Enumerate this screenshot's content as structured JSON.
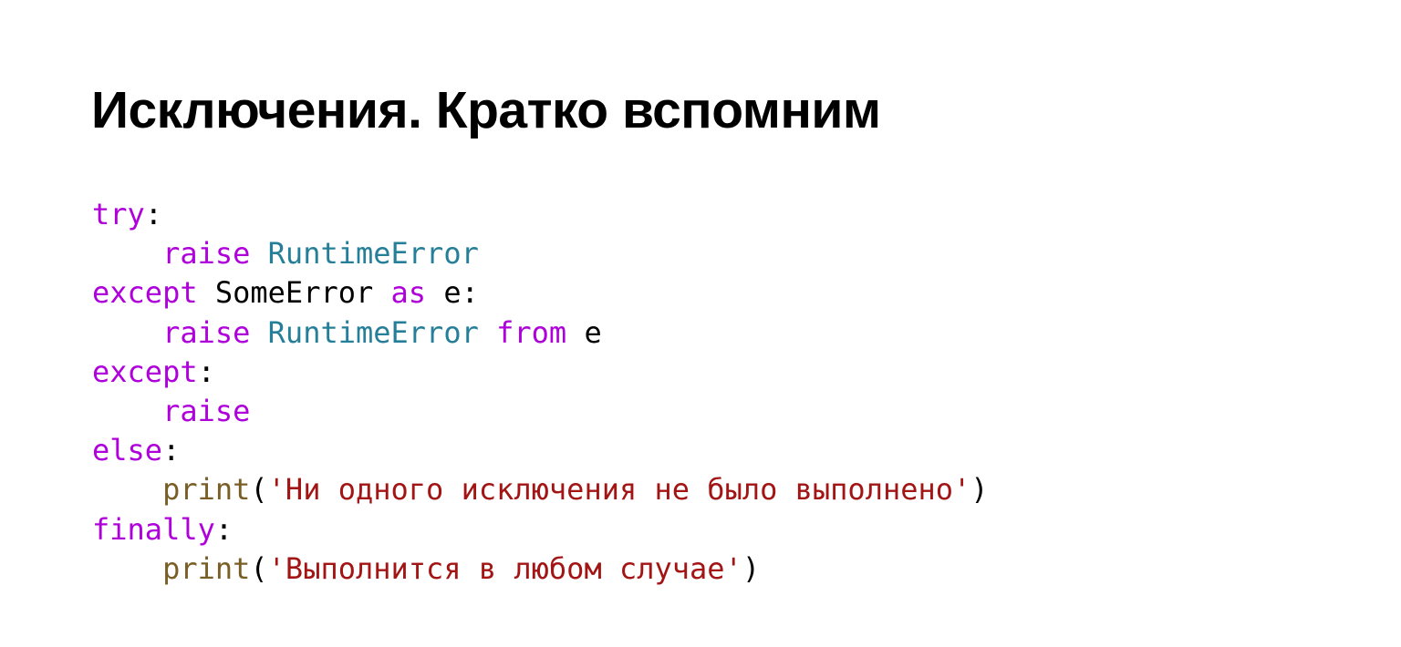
{
  "slide": {
    "title": "Исключения. Кратко вспомним"
  },
  "code": {
    "language": "python",
    "lines": [
      [
        {
          "t": "kw",
          "v": "try"
        },
        {
          "t": "pl",
          "v": ":"
        }
      ],
      [
        {
          "t": "pl",
          "v": "    "
        },
        {
          "t": "kw",
          "v": "raise"
        },
        {
          "t": "pl",
          "v": " "
        },
        {
          "t": "cls",
          "v": "RuntimeError"
        }
      ],
      [
        {
          "t": "kw",
          "v": "except"
        },
        {
          "t": "pl",
          "v": " SomeError "
        },
        {
          "t": "kw",
          "v": "as"
        },
        {
          "t": "pl",
          "v": " e:"
        }
      ],
      [
        {
          "t": "pl",
          "v": "    "
        },
        {
          "t": "kw",
          "v": "raise"
        },
        {
          "t": "pl",
          "v": " "
        },
        {
          "t": "cls",
          "v": "RuntimeError"
        },
        {
          "t": "pl",
          "v": " "
        },
        {
          "t": "kw",
          "v": "from"
        },
        {
          "t": "pl",
          "v": " e"
        }
      ],
      [
        {
          "t": "kw",
          "v": "except"
        },
        {
          "t": "pl",
          "v": ":"
        }
      ],
      [
        {
          "t": "pl",
          "v": "    "
        },
        {
          "t": "kw",
          "v": "raise"
        }
      ],
      [
        {
          "t": "kw",
          "v": "else"
        },
        {
          "t": "pl",
          "v": ":"
        }
      ],
      [
        {
          "t": "pl",
          "v": "    "
        },
        {
          "t": "fn",
          "v": "print"
        },
        {
          "t": "pl",
          "v": "("
        },
        {
          "t": "str",
          "v": "'Ни одного исключения не было выполнено'"
        },
        {
          "t": "pl",
          "v": ")"
        }
      ],
      [
        {
          "t": "kw",
          "v": "finally"
        },
        {
          "t": "pl",
          "v": ":"
        }
      ],
      [
        {
          "t": "pl",
          "v": "    "
        },
        {
          "t": "fn",
          "v": "print"
        },
        {
          "t": "pl",
          "v": "("
        },
        {
          "t": "str",
          "v": "'Выполнится в любом случае'"
        },
        {
          "t": "pl",
          "v": ")"
        }
      ]
    ]
  },
  "colors": {
    "keyword": "#af00db",
    "class": "#267f99",
    "function": "#795e26",
    "string": "#a31515",
    "plain": "#000000"
  }
}
